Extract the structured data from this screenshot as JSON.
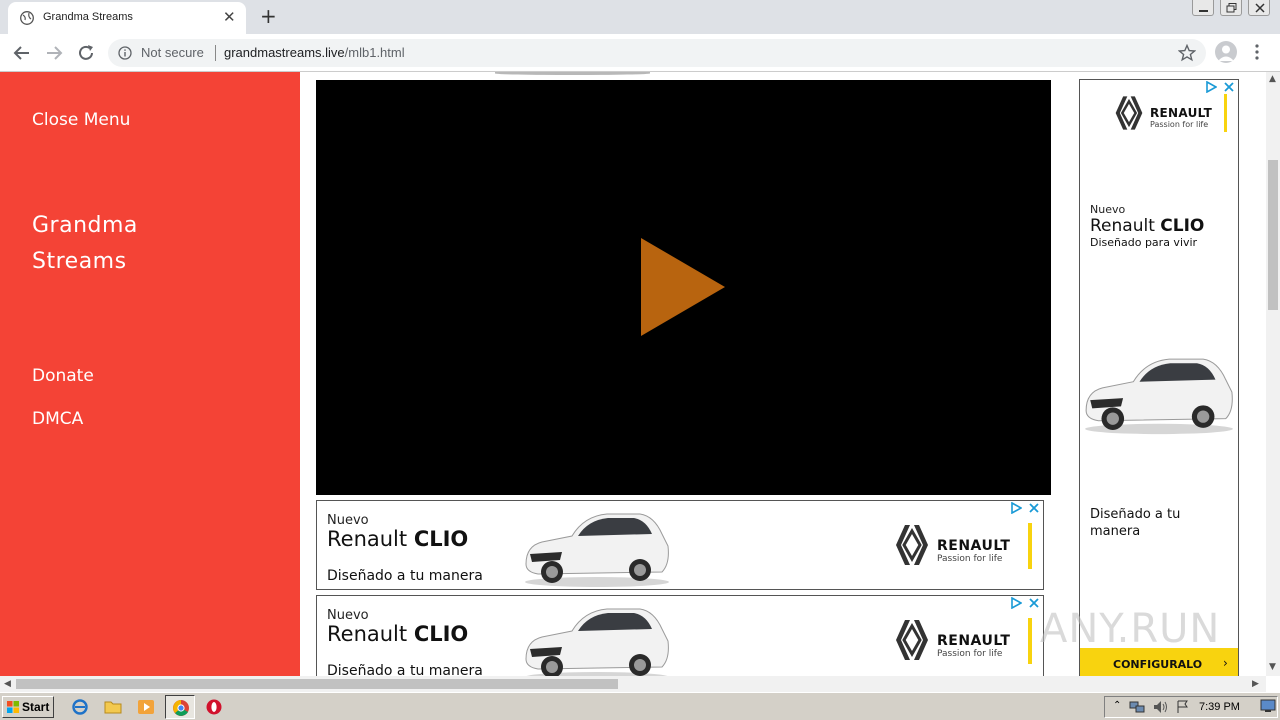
{
  "browser": {
    "tab_title": "Grandma Streams",
    "new_tab_symbol": "+",
    "close_tab_symbol": "✕",
    "security_label": "Not secure",
    "url_host": "grandmastreams.live",
    "url_path": "/mlb1.html"
  },
  "sidebar": {
    "close_menu": "Close Menu",
    "brand_line1": "Grandma",
    "brand_line2": "Streams",
    "items": [
      {
        "label": "Donate"
      },
      {
        "label": "DMCA"
      }
    ],
    "color": "#f44336"
  },
  "player": {
    "play_icon": "play-icon",
    "play_color": "#b8640f"
  },
  "ads": {
    "horizontal": [
      {
        "nuevo": "Nuevo",
        "model_a": "Renault ",
        "model_b": "CLIO",
        "tagline": "Diseñado a tu manera",
        "brand": "RENAULT",
        "passion": "Passion for life"
      },
      {
        "nuevo": "Nuevo",
        "model_a": "Renault ",
        "model_b": "CLIO",
        "tagline": "Diseñado a tu manera",
        "brand": "RENAULT",
        "passion": "Passion for life"
      }
    ],
    "vertical": {
      "brand": "RENAULT",
      "passion": "Passion for life",
      "nuevo": "Nuevo",
      "model_a": "Renault ",
      "model_b": "CLIO",
      "sub": "Diseñado para vivir",
      "tagline": "Diseñado a tu manera",
      "cta": "CONFIGURALO",
      "cta_arrow": "›"
    },
    "accent": "#f8d30f"
  },
  "watermark": "ANY.RUN",
  "taskbar": {
    "start_label": "Start",
    "clock": "7:39 PM"
  }
}
